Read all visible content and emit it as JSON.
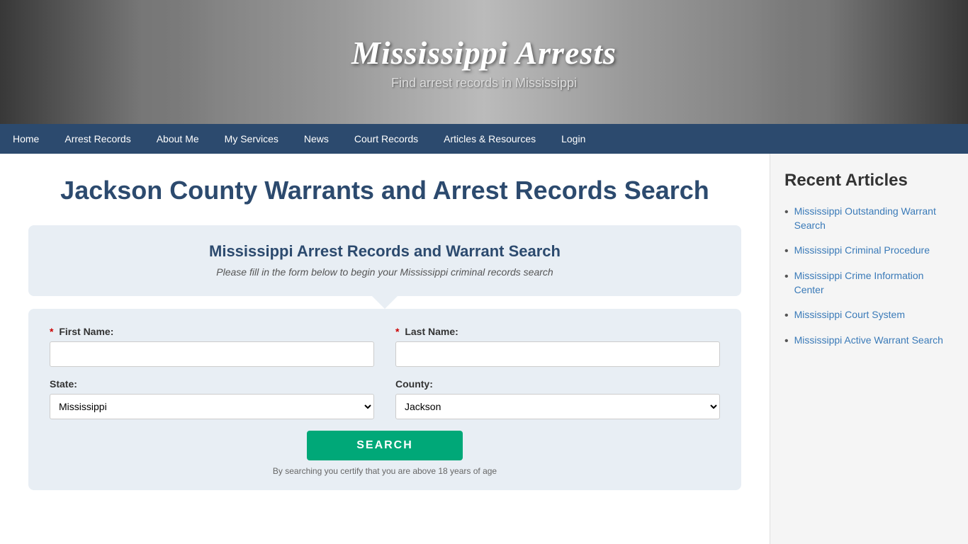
{
  "header": {
    "site_title": "Mississippi Arrests",
    "site_subtitle": "Find arrest records in Mississippi"
  },
  "nav": {
    "items": [
      {
        "label": "Home",
        "active": false
      },
      {
        "label": "Arrest Records",
        "active": false
      },
      {
        "label": "About Me",
        "active": false
      },
      {
        "label": "My Services",
        "active": false
      },
      {
        "label": "News",
        "active": false
      },
      {
        "label": "Court Records",
        "active": false
      },
      {
        "label": "Articles & Resources",
        "active": false
      },
      {
        "label": "Login",
        "active": false
      }
    ]
  },
  "main": {
    "page_title": "Jackson County Warrants and Arrest Records Search",
    "search_card": {
      "title": "Mississippi Arrest Records and Warrant Search",
      "subtitle": "Please fill in the form below to begin your Mississippi criminal records search"
    },
    "form": {
      "first_name_label": "First Name:",
      "last_name_label": "Last Name:",
      "state_label": "State:",
      "county_label": "County:",
      "state_value": "Mississippi",
      "county_value": "Jackson",
      "search_button": "SEARCH",
      "certify_text": "By searching you certify that you are above 18 years of age",
      "required_symbol": "*",
      "first_name_placeholder": "",
      "last_name_placeholder": ""
    }
  },
  "sidebar": {
    "title": "Recent Articles",
    "articles": [
      {
        "label": "Mississippi Outstanding Warrant Search"
      },
      {
        "label": "Mississippi Criminal Procedure"
      },
      {
        "label": "Mississippi Crime Information Center"
      },
      {
        "label": "Mississippi Court System"
      },
      {
        "label": "Mississippi Active Warrant Search"
      }
    ]
  }
}
